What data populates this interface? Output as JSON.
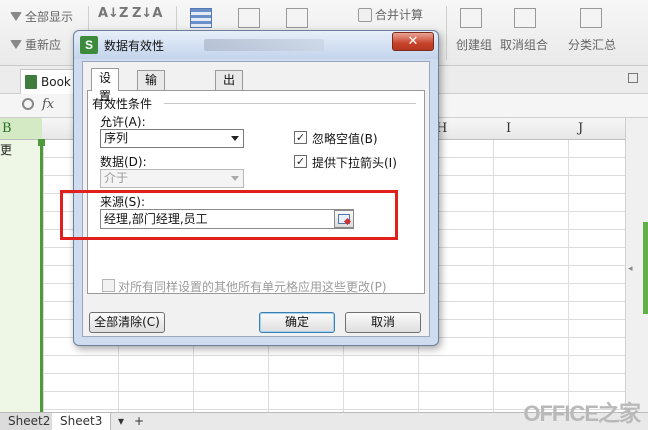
{
  "ribbon": {
    "show_all": "全部显示",
    "reapply": "重新应",
    "merge_calc": "合并计算",
    "create_group": "创建组",
    "ungroup": "取消组合",
    "subtotal": "分类汇总"
  },
  "doc_tab": {
    "label": "Book"
  },
  "formula_bar": {
    "fx": "fx"
  },
  "columns": {
    "b": "B",
    "h": "H",
    "i": "I",
    "j": "J"
  },
  "cells": {
    "b1": "更"
  },
  "sheets": {
    "tabs": [
      "Sheet2",
      "Sheet3"
    ],
    "add": "+"
  },
  "watermark": "OFFICE之家",
  "dialog": {
    "app_icon": "S",
    "title": "数据有效性",
    "close": "✕",
    "tabs": [
      "设置",
      "输入信息",
      "出错警告"
    ],
    "group_title": "有效性条件",
    "allow_label": "允许(A):",
    "allow_value": "序列",
    "data_label": "数据(D):",
    "data_value": "介于",
    "ignore_blank": {
      "label": "忽略空值(B)",
      "checked": true
    },
    "dropdown": {
      "label": "提供下拉箭头(I)",
      "checked": true
    },
    "source_label": "来源(S):",
    "source_value": "经理,部门经理,员工",
    "apply_all": "对所有同样设置的其他所有单元格应用这些更改(P)",
    "clear_all": "全部清除(C)",
    "ok": "确定",
    "cancel": "取消"
  },
  "colors": {
    "accent_green": "#4f9a3a",
    "highlight_red": "#e0201c",
    "dialog_frame": "#cfdcf0"
  }
}
